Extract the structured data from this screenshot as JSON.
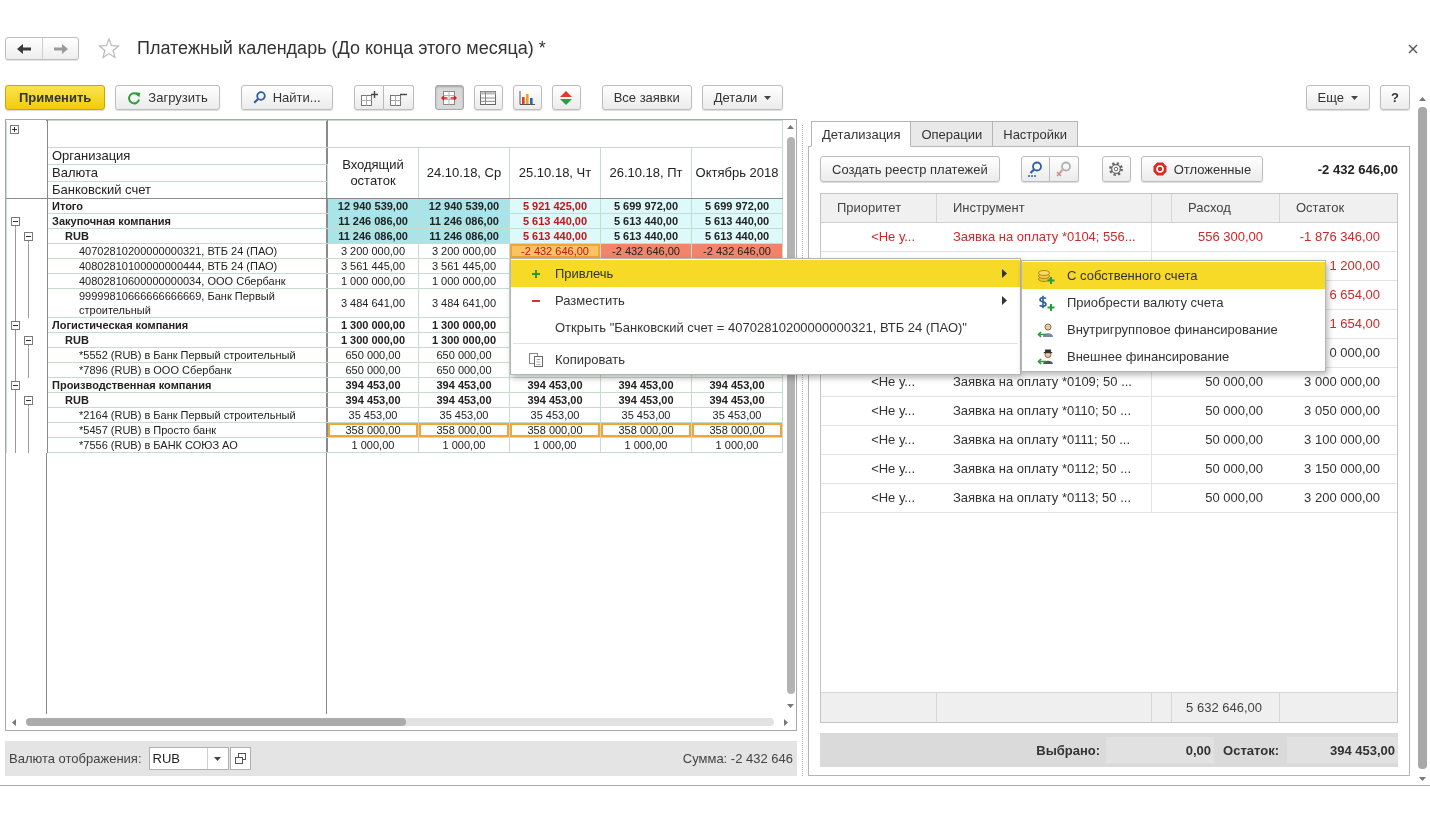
{
  "window": {
    "title": "Платежный календарь (До конца этого месяца) *"
  },
  "toolbar": {
    "apply": "Применить",
    "load": "Загрузить",
    "find": "Найти...",
    "view_toggles": [
      {
        "pressed": true
      },
      {
        "pressed": false
      },
      {
        "pressed": false
      },
      {
        "pressed": false
      }
    ],
    "all_requests": "Все заявки",
    "details": "Детали",
    "more": "Еще",
    "help": "?"
  },
  "calendar": {
    "row_headers": [
      "Организация",
      "Валюта",
      "Банковский счет"
    ],
    "columns": [
      "Входящий остаток",
      "24.10.18, Ср",
      "25.10.18, Чт",
      "26.10.18, Пт",
      "Октябрь 2018"
    ],
    "total": {
      "name": "Итого",
      "cells": [
        {
          "text": "12 940 539,00",
          "color": "#a9e4e8",
          "alert": false,
          "outlined": false
        },
        {
          "text": "12 940 539,00",
          "color": "#a9e4e8",
          "alert": false,
          "outlined": false
        },
        {
          "text": "5 921 425,00",
          "color": "#ddf9f9",
          "alert": true,
          "outlined": false
        },
        {
          "text": "5 699 972,00",
          "color": "#ddf9f9",
          "alert": false,
          "outlined": false
        },
        {
          "text": "5 699 972,00",
          "color": "#ddf9f9",
          "alert": false,
          "outlined": false
        }
      ]
    },
    "rows": [
      {
        "name": "Закупочная компания",
        "expanded": true,
        "cells": [
          {
            "text": "11 246 086,00",
            "color": "#a9e4e8",
            "alert": false,
            "outlined": false
          },
          {
            "text": "11 246 086,00",
            "color": "#a9e4e8",
            "alert": false,
            "outlined": false
          },
          {
            "text": "5 613 440,00",
            "color": "#ddf9f9",
            "alert": true,
            "outlined": false
          },
          {
            "text": "5 613 440,00",
            "color": "#ddf9f9",
            "alert": false,
            "outlined": false
          },
          {
            "text": "5 613 440,00",
            "color": "#ddf9f9",
            "alert": false,
            "outlined": false
          }
        ],
        "children": [
          {
            "name": "RUB",
            "expanded": true,
            "cells": [
              {
                "text": "11 246 086,00",
                "color": "#a9e4e8",
                "alert": false,
                "outlined": false
              },
              {
                "text": "11 246 086,00",
                "color": "#a9e4e8",
                "alert": false,
                "outlined": false
              },
              {
                "text": "5 613 440,00",
                "color": "#ddf9f9",
                "alert": true,
                "outlined": false
              },
              {
                "text": "5 613 440,00",
                "color": "#ddf9f9",
                "alert": false,
                "outlined": false
              },
              {
                "text": "5 613 440,00",
                "color": "#ddf9f9",
                "alert": false,
                "outlined": false
              }
            ],
            "children": [
              {
                "name": "40702810200000000321, ВТБ 24 (ПАО)",
                "cells": [
                  {
                    "text": "3 200 000,00",
                    "alert": false,
                    "outlined": false
                  },
                  {
                    "text": "3 200 000,00",
                    "alert": false,
                    "outlined": false
                  },
                  {
                    "text": "-2 432 646,00",
                    "color": "#f9c262",
                    "alert": true,
                    "outlined": true
                  },
                  {
                    "text": "-2 432 646,00",
                    "color": "#f2846c",
                    "alert": false,
                    "outlined": false
                  },
                  {
                    "text": "-2 432 646,00",
                    "color": "#f2846c",
                    "alert": false,
                    "outlined": false
                  }
                ]
              },
              {
                "name": "40802810100000000444, ВТБ 24 (ПАО)",
                "cells": [
                  {
                    "text": "3 561 445,00",
                    "alert": false,
                    "outlined": false
                  },
                  {
                    "text": "3 561 445,00",
                    "alert": false,
                    "outlined": false
                  }
                ]
              },
              {
                "name": "40802810600000000034, ООО Сбербанк",
                "cells": [
                  {
                    "text": "1 000 000,00",
                    "alert": false,
                    "outlined": false
                  },
                  {
                    "text": "1 000 000,00",
                    "alert": false,
                    "outlined": false
                  }
                ]
              },
              {
                "name": "99999810666666666669, Банк Первый строительный",
                "cells": [
                  {
                    "text": "3 484 641,00",
                    "alert": false,
                    "outlined": false
                  },
                  {
                    "text": "3 484 641,00",
                    "alert": false,
                    "outlined": false
                  }
                ]
              }
            ]
          }
        ]
      },
      {
        "name": "Логистическая компания",
        "expanded": true,
        "cells": [
          {
            "text": "1 300 000,00",
            "alert": false,
            "outlined": false
          },
          {
            "text": "1 300 000,00",
            "alert": false,
            "outlined": false
          }
        ],
        "children": [
          {
            "name": "RUB",
            "expanded": true,
            "cells": [
              {
                "text": "1 300 000,00",
                "alert": false,
                "outlined": false
              },
              {
                "text": "1 300 000,00",
                "alert": false,
                "outlined": false
              }
            ],
            "children": [
              {
                "name": "*5552 (RUB) в Банк Первый строительный",
                "cells": [
                  {
                    "text": "650 000,00",
                    "alert": false,
                    "outlined": false
                  },
                  {
                    "text": "650 000,00",
                    "alert": false,
                    "outlined": false
                  }
                ]
              },
              {
                "name": "*7896 (RUB) в ООО Сбербанк",
                "cells": [
                  {
                    "text": "650 000,00",
                    "alert": false,
                    "outlined": false
                  },
                  {
                    "text": "650 000,00",
                    "alert": false,
                    "outlined": false
                  }
                ]
              }
            ]
          }
        ]
      },
      {
        "name": "Производственная компания",
        "expanded": true,
        "cells": [
          {
            "text": "394 453,00",
            "alert": false,
            "outlined": false
          },
          {
            "text": "394 453,00",
            "alert": false,
            "outlined": false
          },
          {
            "text": "394 453,00",
            "alert": false,
            "outlined": false
          },
          {
            "text": "394 453,00",
            "alert": false,
            "outlined": false
          },
          {
            "text": "394 453,00",
            "alert": false,
            "outlined": false
          }
        ],
        "children": [
          {
            "name": "RUB",
            "expanded": true,
            "cells": [
              {
                "text": "394 453,00",
                "alert": false,
                "outlined": false
              },
              {
                "text": "394 453,00",
                "alert": false,
                "outlined": false
              },
              {
                "text": "394 453,00",
                "alert": false,
                "outlined": false
              },
              {
                "text": "394 453,00",
                "alert": false,
                "outlined": false
              },
              {
                "text": "394 453,00",
                "alert": false,
                "outlined": false
              }
            ],
            "children": [
              {
                "name": "*2164 (RUB) в Банк Первый строительный",
                "cells": [
                  {
                    "text": "35 453,00",
                    "alert": false,
                    "outlined": false
                  },
                  {
                    "text": "35 453,00",
                    "alert": false,
                    "outlined": false
                  },
                  {
                    "text": "35 453,00",
                    "alert": false,
                    "outlined": false
                  },
                  {
                    "text": "35 453,00",
                    "alert": false,
                    "outlined": false
                  },
                  {
                    "text": "35 453,00",
                    "alert": false,
                    "outlined": false
                  }
                ]
              },
              {
                "name": "*5457 (RUB) в Просто банк",
                "cells": [
                  {
                    "text": "358 000,00",
                    "alert": false,
                    "outlined": true
                  },
                  {
                    "text": "358 000,00",
                    "alert": false,
                    "outlined": true
                  },
                  {
                    "text": "358 000,00",
                    "alert": false,
                    "outlined": true
                  },
                  {
                    "text": "358 000,00",
                    "alert": false,
                    "outlined": true
                  },
                  {
                    "text": "358 000,00",
                    "alert": false,
                    "outlined": true
                  }
                ]
              },
              {
                "name": "*7556 (RUB) в БАНК СОЮЗ АО",
                "cells": [
                  {
                    "text": "1 000,00",
                    "alert": false,
                    "outlined": false
                  },
                  {
                    "text": "1 000,00",
                    "alert": false,
                    "outlined": false
                  },
                  {
                    "text": "1 000,00",
                    "alert": false,
                    "outlined": false
                  },
                  {
                    "text": "1 000,00",
                    "alert": false,
                    "outlined": false
                  },
                  {
                    "text": "1 000,00",
                    "alert": false,
                    "outlined": false
                  }
                ]
              }
            ]
          }
        ]
      }
    ]
  },
  "display_currency": {
    "label": "Валюта отображения:",
    "value": "RUB"
  },
  "sum": "Сумма: -2 432 646",
  "details_panel": {
    "tabs": [
      {
        "label": "Детализация",
        "selected": true
      },
      {
        "label": "Операции",
        "selected": false
      },
      {
        "label": "Настройки",
        "selected": false
      }
    ],
    "create_registry": "Создать реестр платежей",
    "search_buttons": [
      {
        "disabled": false
      },
      {
        "disabled": true
      }
    ],
    "postponed": "Отложенные",
    "total": "-2 432 646,00",
    "table": {
      "columns": [
        "Приоритет",
        "Инструмент",
        "Расход",
        "Остаток"
      ],
      "rows": [
        {
          "priority": "<Не у...",
          "instrument": "Заявка на оплату *0104; 556...",
          "expense": "556 300,00",
          "balance": "-1 876 346,00",
          "alert": true
        },
        {
          "balance": "1 200,00",
          "alert": true
        },
        {
          "balance": "6 654,00",
          "alert": true
        },
        {
          "balance": "1 654,00",
          "alert": true
        },
        {
          "balance": "0 000,00",
          "alert": false
        },
        {
          "priority": "<Не у...",
          "instrument": "Заявка на оплату *0109; 50 ...",
          "expense": "50 000,00",
          "balance": "3 000 000,00",
          "alert": false
        },
        {
          "priority": "<Не у...",
          "instrument": "Заявка на оплату *0110; 50 ...",
          "expense": "50 000,00",
          "balance": "3 050 000,00",
          "alert": false
        },
        {
          "priority": "<Не у...",
          "instrument": "Заявка на оплату *0111; 50 ...",
          "expense": "50 000,00",
          "balance": "3 100 000,00",
          "alert": false
        },
        {
          "priority": "<Не у...",
          "instrument": "Заявка на оплату *0112; 50 ...",
          "expense": "50 000,00",
          "balance": "3 150 000,00",
          "alert": false
        },
        {
          "priority": "<Не у...",
          "instrument": "Заявка на оплату *0113; 50 ...",
          "expense": "50 000,00",
          "balance": "3 200 000,00",
          "alert": false
        }
      ],
      "footer": {
        "expense": "5 632 646,00"
      }
    },
    "summary": {
      "selected_label": "Выбрано:",
      "selected_value": "0,00",
      "balance_label": "Остаток:",
      "balance_value": "394 453,00"
    }
  },
  "context_menu": {
    "groups": [
      [
        {
          "label": "Привлечь",
          "selected": true,
          "submenu": true
        },
        {
          "label": "Разместить",
          "selected": false,
          "submenu": true
        },
        {
          "label": "Открыть \"Банковский счет = 40702810200000000321, ВТБ 24 (ПАО)\"",
          "selected": false,
          "submenu": false
        }
      ],
      [
        {
          "label": "Копировать",
          "selected": false,
          "submenu": false
        }
      ]
    ],
    "submenu": [
      {
        "label": "С собственного счета",
        "selected": true
      },
      {
        "label": "Приобрести валюту счета",
        "selected": false
      },
      {
        "label": "Внутригрупповое финансирование",
        "selected": false
      },
      {
        "label": "Внешнее финансирование",
        "selected": false
      }
    ]
  }
}
